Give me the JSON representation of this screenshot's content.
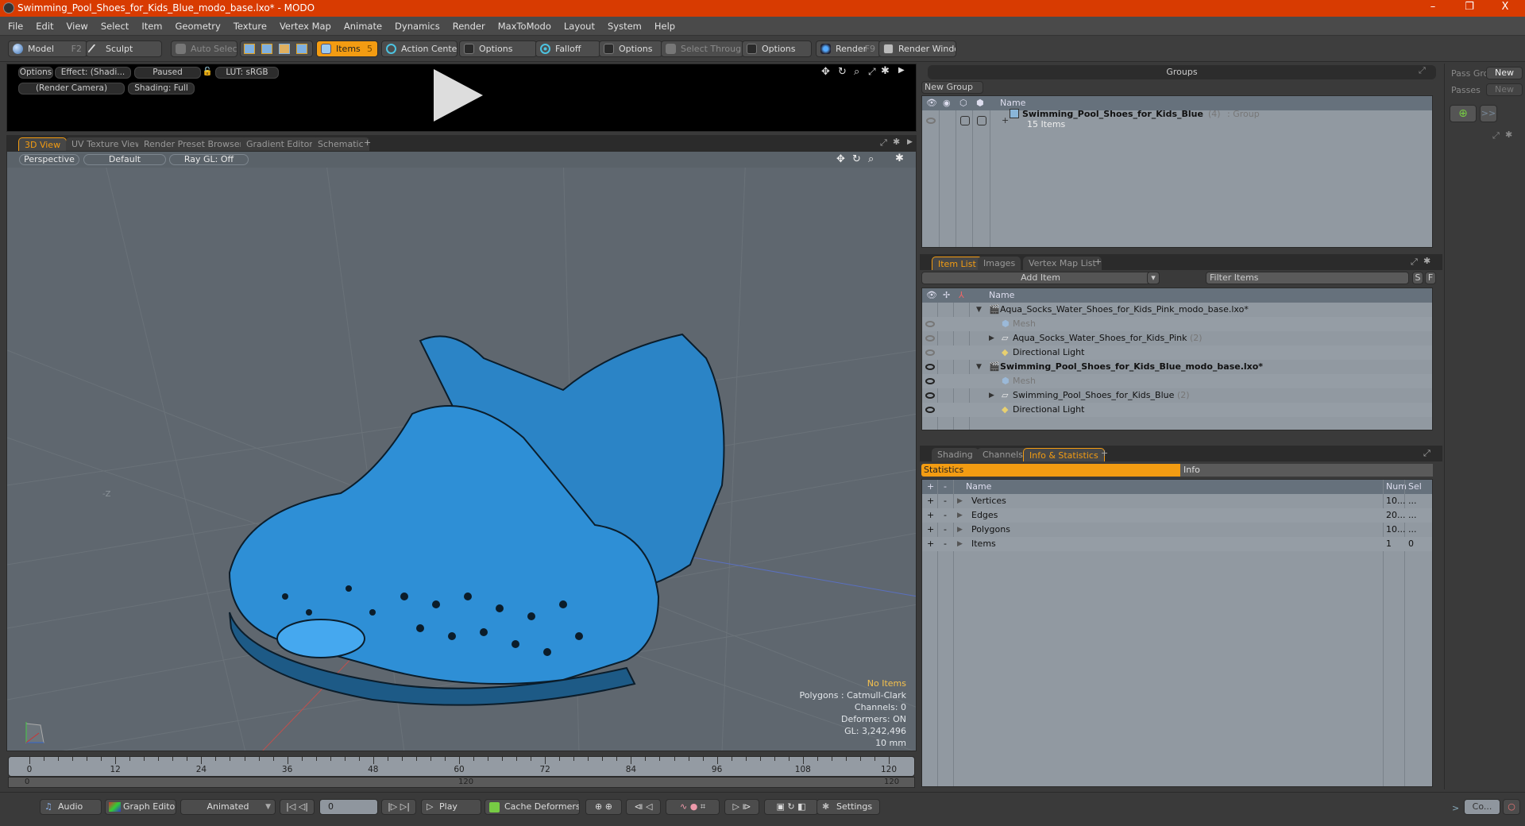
{
  "window": {
    "title": "Swimming_Pool_Shoes_for_Kids_Blue_modo_base.lxo* - MODO",
    "controls": {
      "minimize": "–",
      "restore": "❐",
      "close": "X"
    }
  },
  "menu": [
    "File",
    "Edit",
    "View",
    "Select",
    "Item",
    "Geometry",
    "Texture",
    "Vertex Map",
    "Animate",
    "Dynamics",
    "Render",
    "MaxToModo",
    "Layout",
    "System",
    "Help"
  ],
  "toolbar": {
    "model": "Model",
    "model_key": "F2",
    "sculpt": "Sculpt",
    "auto_select": "Auto Select",
    "items": "Items",
    "items_key": "5",
    "action_center": "Action Center",
    "options1": "Options",
    "falloff": "Falloff",
    "options2": "Options",
    "select_through": "Select Through",
    "options3": "Options",
    "render": "Render",
    "render_key": "F9",
    "render_window": "Render Window"
  },
  "preview": {
    "options": "Options",
    "effect": "Effect: (Shadi...",
    "paused": "Paused",
    "lut": "LUT: sRGB",
    "camera": "(Render Camera)",
    "shading": "Shading: Full"
  },
  "viewport_tabs": [
    {
      "label": "3D View",
      "selected": true
    },
    {
      "label": "UV Texture View"
    },
    {
      "label": "Render Preset Browser"
    },
    {
      "label": "Gradient Editor"
    },
    {
      "label": "Schematic"
    }
  ],
  "viewport": {
    "projection": "Perspective",
    "style": "Default",
    "raygl": "Ray GL: Off",
    "axis_label": "-Z",
    "hud": {
      "items": "No Items",
      "polygons": "Polygons : Catmull-Clark",
      "channels": "Channels: 0",
      "deformers": "Deformers: ON",
      "gl": "GL: 3,242,496",
      "unit": "10 mm"
    },
    "mesh_color": "#2e8fd6"
  },
  "timeline": {
    "ticks": [
      "0",
      "12",
      "24",
      "36",
      "48",
      "60",
      "72",
      "84",
      "96",
      "108",
      "120"
    ],
    "range_start": "0",
    "range_mid": "120",
    "range_end": "120"
  },
  "bottombar": {
    "audio": "Audio",
    "graph_editor": "Graph Editor",
    "animated": "Animated",
    "frame": "0",
    "play": "Play",
    "cache_deformers": "Cache Deformers",
    "settings": "Settings",
    "command": "Co..."
  },
  "groups_panel": {
    "title": "Groups",
    "new_group": "New Group",
    "col_name": "Name",
    "row": {
      "name": "Swimming_Pool_Shoes_for_Kids_Blue",
      "count": "(4)",
      "type": ": Group",
      "sub": "15 Items"
    }
  },
  "pass_panel": {
    "pass_groups": "Pass Gro",
    "passes": "Passes",
    "new1": "New",
    "new2": "New",
    "more": ">>"
  },
  "item_list": {
    "tabs": [
      {
        "label": "Item List",
        "selected": true
      },
      {
        "label": "Images"
      },
      {
        "label": "Vertex Map List"
      }
    ],
    "add_item": "Add Item",
    "filter_placeholder": "Filter Items",
    "s": "S",
    "f": "F",
    "col_name": "Name",
    "rows": [
      {
        "name": "Aqua_Socks_Water_Shoes_for_Kids_Pink_modo_base.lxo*",
        "level": 0,
        "kind": "scene",
        "bold": false,
        "eye": "none"
      },
      {
        "name": "Mesh",
        "level": 1,
        "kind": "mesh",
        "dim": true,
        "eye": "dim"
      },
      {
        "name": "Aqua_Socks_Water_Shoes_for_Kids_Pink",
        "count": "(2)",
        "level": 1,
        "kind": "group",
        "eye": "dim"
      },
      {
        "name": "Directional Light",
        "level": 1,
        "kind": "light",
        "eye": "dim"
      },
      {
        "name": "Swimming_Pool_Shoes_for_Kids_Blue_modo_base.lxo*",
        "level": 0,
        "kind": "scene",
        "bold": true,
        "eye": "on"
      },
      {
        "name": "Mesh",
        "level": 1,
        "kind": "mesh",
        "dim": true,
        "eye": "on"
      },
      {
        "name": "Swimming_Pool_Shoes_for_Kids_Blue",
        "count": "(2)",
        "level": 1,
        "kind": "group",
        "eye": "on"
      },
      {
        "name": "Directional Light",
        "level": 1,
        "kind": "light",
        "eye": "on"
      }
    ]
  },
  "stats_panel": {
    "tabs": [
      {
        "label": "Shading"
      },
      {
        "label": "Channels"
      },
      {
        "label": "Info & Statistics",
        "selected": true
      }
    ],
    "statistics": "Statistics",
    "info": "Info",
    "cols": {
      "plus": "+",
      "minus": "-",
      "name": "Name",
      "num": "Num",
      "sel": "Sel"
    },
    "rows": [
      {
        "name": "Vertices",
        "num": "10...",
        "sel": "..."
      },
      {
        "name": "Edges",
        "num": "20...",
        "sel": "..."
      },
      {
        "name": "Polygons",
        "num": "10...",
        "sel": "..."
      },
      {
        "name": "Items",
        "num": "1",
        "sel": "0"
      }
    ]
  },
  "colors": {
    "accent": "#f39c12",
    "titlebar": "#d83b01"
  }
}
